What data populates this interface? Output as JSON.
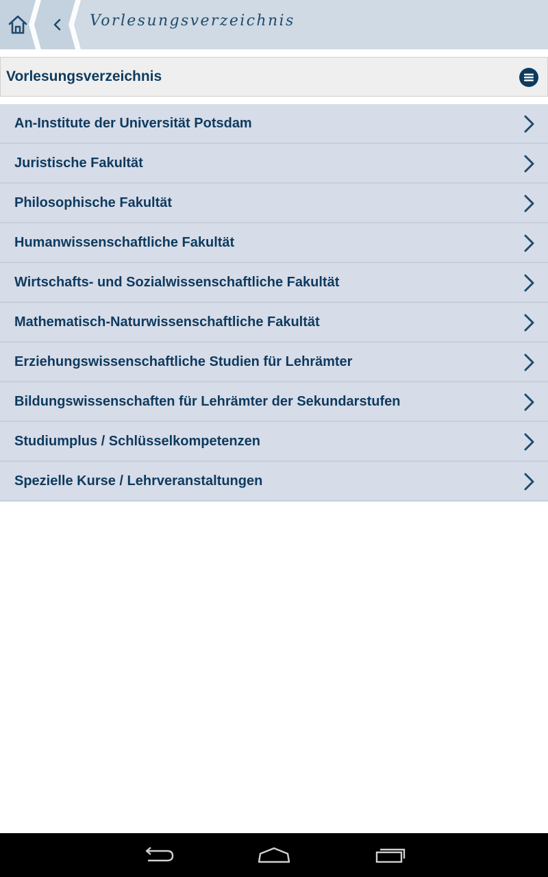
{
  "topbar": {
    "title": "Vorlesungsverzeichnis",
    "home_icon": "home-icon",
    "back_icon": "chevron-left-icon"
  },
  "section": {
    "title": "Vorlesungsverzeichnis",
    "menu_icon": "menu-icon"
  },
  "items": [
    {
      "label": "An-Institute der Universität Potsdam"
    },
    {
      "label": "Juristische Fakultät"
    },
    {
      "label": "Philosophische Fakultät"
    },
    {
      "label": "Humanwissenschaftliche Fakultät"
    },
    {
      "label": "Wirtschafts- und Sozialwissenschaftliche Fakultät"
    },
    {
      "label": "Mathematisch-Naturwissenschaftliche Fakultät"
    },
    {
      "label": "Erziehungswissenschaftliche Studien für Lehrämter"
    },
    {
      "label": "Bildungswissenschaften für Lehrämter der Sekundarstufen"
    },
    {
      "label": "Studiumplus / Schlüsselkompetenzen"
    },
    {
      "label": "Spezielle Kurse / Lehrveranstaltungen"
    }
  ],
  "colors": {
    "topbar_bg": "#cfdae5",
    "text_primary": "#0e3a5e",
    "list_bg": "#d6dce8",
    "accent": "#1e4a6b"
  },
  "navbar": {
    "back_icon": "nav-back-icon",
    "home_icon": "nav-home-icon",
    "recents_icon": "nav-recents-icon"
  }
}
